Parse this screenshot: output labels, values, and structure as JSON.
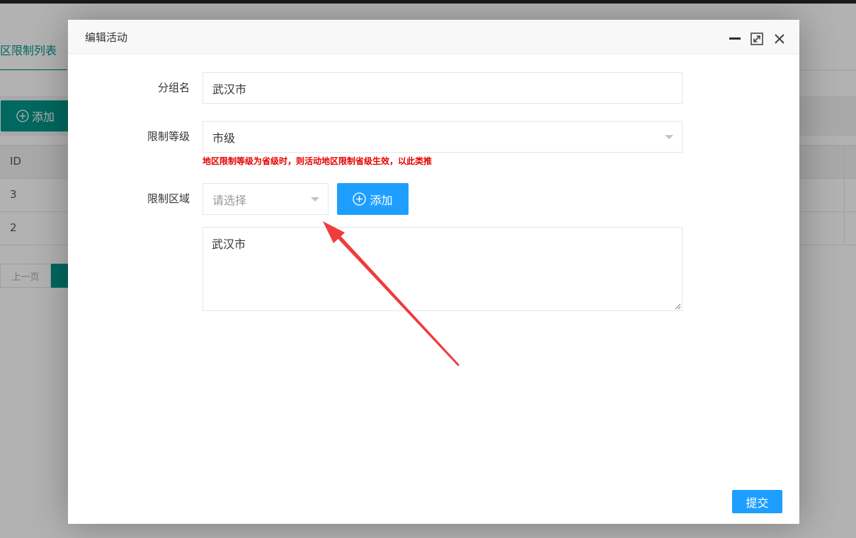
{
  "background": {
    "tab_label": "区限制列表",
    "add_button_label": "添加",
    "table_header_id": "ID",
    "rows": [
      "3",
      "2"
    ],
    "pager_prev": "上一页"
  },
  "dialog": {
    "title": "编辑活动",
    "fields": {
      "group_name_label": "分组名",
      "group_name_value": "武汉市",
      "level_label": "限制等级",
      "level_value": "市级",
      "level_hint": "地区限制等级为省级时，则活动地区限制省级生效，以此类推",
      "region_label": "限制区域",
      "region_placeholder": "请选择",
      "region_add_label": "添加",
      "region_textarea_value": "武汉市"
    },
    "submit_label": "提交"
  },
  "colors": {
    "primary_teal": "#009688",
    "primary_blue": "#1e9fff",
    "hint_red": "#e60000",
    "annotation_arrow": "#f03c3c"
  }
}
